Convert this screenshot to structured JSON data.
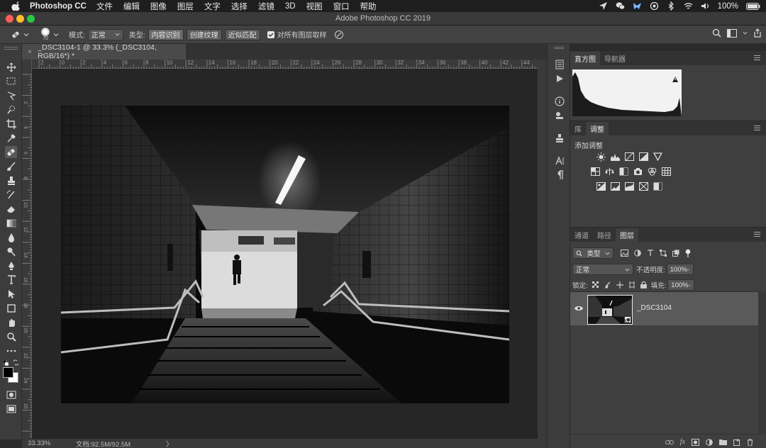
{
  "menubar": {
    "app": "Photoshop CC",
    "items": [
      "文件",
      "编辑",
      "图像",
      "图层",
      "文字",
      "选择",
      "滤镜",
      "3D",
      "视图",
      "窗口",
      "帮助"
    ],
    "battery": "100%"
  },
  "window": {
    "title": "Adobe Photoshop CC 2019"
  },
  "options": {
    "brush_size": "70",
    "mode_label": "模式:",
    "mode_value": "正常",
    "type_label": "类型:",
    "type_buttons": [
      "内容识别",
      "创建纹理",
      "近似匹配"
    ],
    "sample_all": "对所有图层取样"
  },
  "document": {
    "tab": "_DSC3104-1 @ 33.3% (_DSC3104, RGB/16*) *",
    "close": "×",
    "ruler_top": [
      "2",
      "0",
      "2",
      "4",
      "6",
      "8",
      "10",
      "12",
      "14",
      "16",
      "18",
      "20",
      "22",
      "24",
      "26",
      "28",
      "30",
      "32",
      "34",
      "36",
      "38",
      "40",
      "42",
      "44"
    ],
    "ruler_left": [
      "2",
      "4",
      "6",
      "8",
      "10",
      "12",
      "14",
      "16",
      "18",
      "20",
      "22",
      "24",
      "26",
      "28"
    ]
  },
  "status": {
    "zoom": "33.33%",
    "doc": "文档:92.5M/92.5M",
    "arrow": "〉"
  },
  "panels": {
    "histogram_tabs": [
      "直方图",
      "导航器"
    ],
    "adjust_tabs": [
      "库",
      "调整"
    ],
    "adjust_title": "添加调整",
    "layers_tabs": [
      "通道",
      "路径",
      "图层"
    ],
    "filter_kind": "类型",
    "blend_mode": "正常",
    "opacity_label": "不透明度:",
    "opacity": "100%",
    "lock_label": "锁定:",
    "fill_label": "填充:",
    "fill": "100%",
    "layer_name": "_DSC3104"
  },
  "colors": {
    "fg": "#000000",
    "bg": "#ffffff",
    "accent": "#5a5a5a"
  }
}
